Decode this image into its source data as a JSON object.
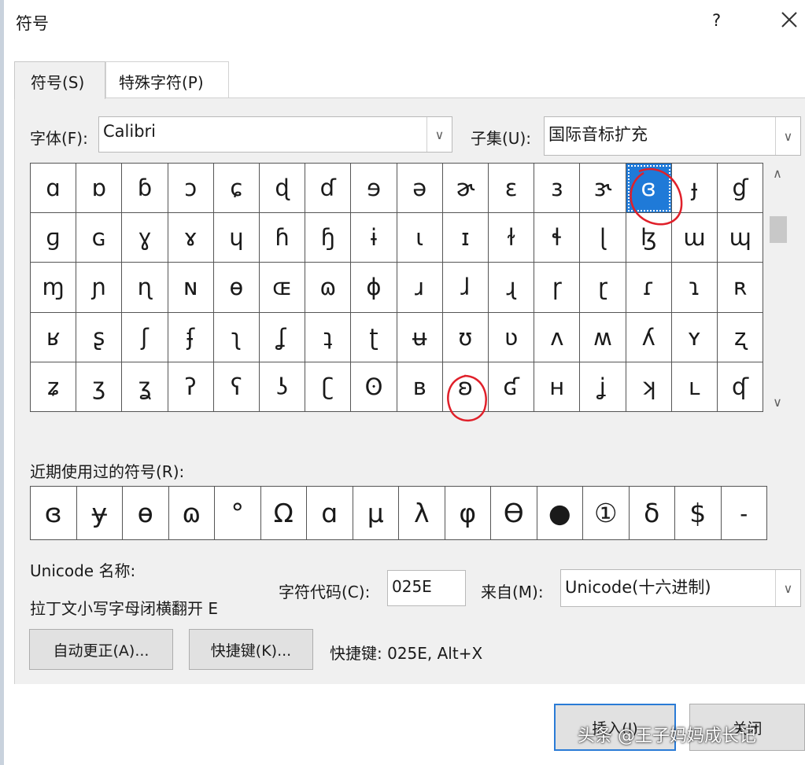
{
  "window": {
    "title": "符号",
    "help_label": "?",
    "close_icon": "close-icon"
  },
  "tabs": [
    {
      "label": "符号(S)"
    },
    {
      "label": "特殊字符(P)"
    }
  ],
  "font": {
    "label": "字体(F):",
    "value": "Calibri"
  },
  "subset": {
    "label": "子集(U):",
    "value": "国际音标扩充"
  },
  "symbols": [
    "ɑ",
    "ɒ",
    "ɓ",
    "ɔ",
    "ɕ",
    "ɖ",
    "ɗ",
    "ɘ",
    "ə",
    "ɚ",
    "ɛ",
    "ɜ",
    "ɝ",
    "ɞ",
    "ɟ",
    "ɠ",
    "ɡ",
    "ɢ",
    "ɣ",
    "ɤ",
    "ɥ",
    "ɦ",
    "ɧ",
    "ɨ",
    "ɩ",
    "ɪ",
    "ɫ",
    "ɬ",
    "ɭ",
    "ɮ",
    "ɯ",
    "ɰ",
    "ɱ",
    "ɲ",
    "ɳ",
    "ɴ",
    "ɵ",
    "ɶ",
    "ɷ",
    "ɸ",
    "ɹ",
    "ɺ",
    "ɻ",
    "ɼ",
    "ɽ",
    "ɾ",
    "ɿ",
    "ʀ",
    "ʁ",
    "ʂ",
    "ʃ",
    "ʄ",
    "ʅ",
    "ʆ",
    "ʇ",
    "ʈ",
    "ʉ",
    "ʊ",
    "ʋ",
    "ʌ",
    "ʍ",
    "ʎ",
    "ʏ",
    "ʐ",
    "ʑ",
    "ʒ",
    "ʓ",
    "ʔ",
    "ʕ",
    "ʖ",
    "ʗ",
    "ʘ",
    "ʙ",
    "ʚ",
    "ʛ",
    "ʜ",
    "ʝ",
    "ʞ",
    "ʟ",
    "ʠ"
  ],
  "selected_symbol": "ɞ",
  "recent": {
    "label": "近期使用过的符号(R):",
    "items": [
      "ɞ",
      "ɏ",
      "ɵ",
      "ɷ",
      "°",
      "Ω",
      "ɑ",
      "μ",
      "λ",
      "φ",
      "ϴ",
      "●",
      "①",
      "δ",
      "$",
      "˗"
    ]
  },
  "unicode_name": {
    "label": "Unicode 名称:",
    "value": "拉丁文小写字母闭横翻开 E"
  },
  "char_code": {
    "label": "字符代码(C):",
    "value": "025E"
  },
  "from": {
    "label": "来自(M):",
    "value": "Unicode(十六进制)"
  },
  "buttons": {
    "autocorrect": "自动更正(A)...",
    "shortcut_key": "快捷键(K)...",
    "insert": "插入(I)",
    "close": "关闭"
  },
  "shortcut_text": "快捷键: 025E, Alt+X",
  "watermark": "头条 @王子妈妈成长记",
  "colors": {
    "selection": "#1f7ad8",
    "annotation": "#e0202a"
  }
}
